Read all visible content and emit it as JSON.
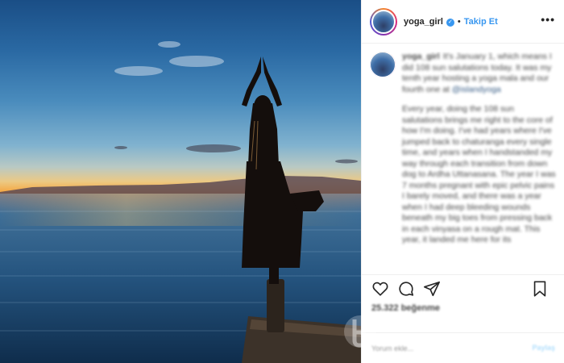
{
  "post": {
    "username": "yoga_girl",
    "separator": "•",
    "follow_label": "Takip Et",
    "more_label": "•••",
    "caption_username": "yoga_girl",
    "caption_paragraphs": [
      "It's January 1, which means I did 108 sun salutations today. It was my tenth year hosting a yoga mala and our fourth one at",
      "Every year, doing the 108 sun salutations brings me right to the core of how I'm doing. I've had years where I've jumped back to chaturanga every single time, and years when I handstanded my way through each transition from down dog to Ardha Uttanasana. The year I was 7 months pregnant with epic pelvic pains I barely moved, and there was a year when I had deep bleeding wounds beneath my big toes from pressing back in each vinyasa on a rough mat. This year, it landed me here for its"
    ],
    "caption_mention": "@islandyoga",
    "likes_text": "25.322 beğenme",
    "time_text": "",
    "comment_placeholder": "Yorum ekle...",
    "post_label": "Paylaş"
  },
  "icons": {
    "verified": "verified-badge-icon",
    "like": "heart-icon",
    "comment": "comment-icon",
    "share": "share-icon",
    "save": "bookmark-icon"
  },
  "colors": {
    "link_blue": "#3897f0",
    "text": "#262626",
    "muted": "#999999",
    "divider": "#efefef"
  }
}
